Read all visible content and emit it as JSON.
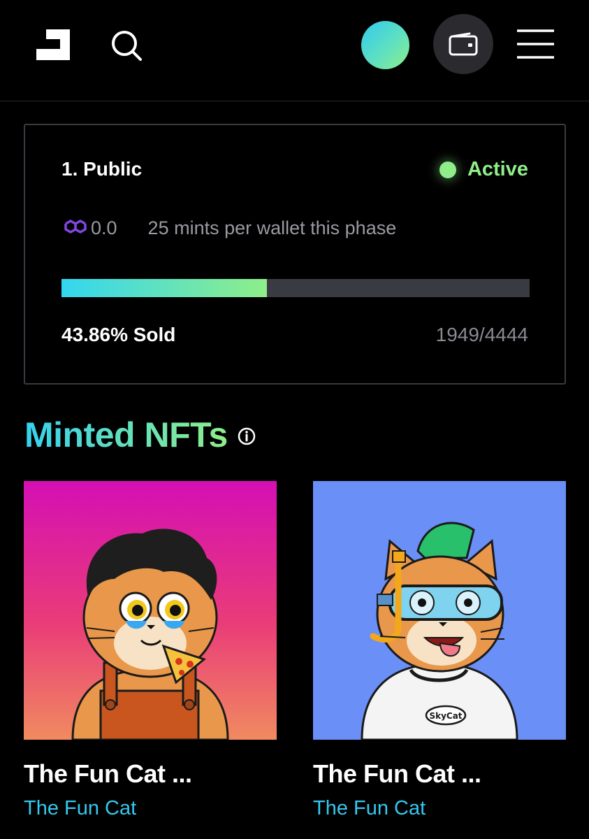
{
  "header": {
    "logo_icon": "brand-logo-icon",
    "search_icon": "search-icon",
    "wallet_icon": "wallet-icon",
    "menu_icon": "hamburger-menu-icon",
    "avatar_gradient": [
      "#33c9f0",
      "#8fee8a"
    ]
  },
  "phase": {
    "title": "1. Public",
    "status": "Active",
    "status_color": "#8fee8a",
    "currency_icon": "polygon-icon",
    "price": "0.0",
    "limit_text": "25 mints per wallet this phase",
    "progress_fraction": 0.4386,
    "sold_label": "43.86% Sold",
    "count": "1949/4444"
  },
  "minted": {
    "title": "Minted NFTs",
    "info_icon": "info-icon",
    "items": [
      {
        "name": "The Fun Cat ...",
        "collection": "The Fun Cat",
        "image": "cat-pizza-overalls-image",
        "bg": "#e0147c"
      },
      {
        "name": "The Fun Cat ...",
        "collection": "The Fun Cat",
        "image": "cat-snorkel-skycat-image",
        "bg": "#6a8ff6"
      }
    ]
  }
}
